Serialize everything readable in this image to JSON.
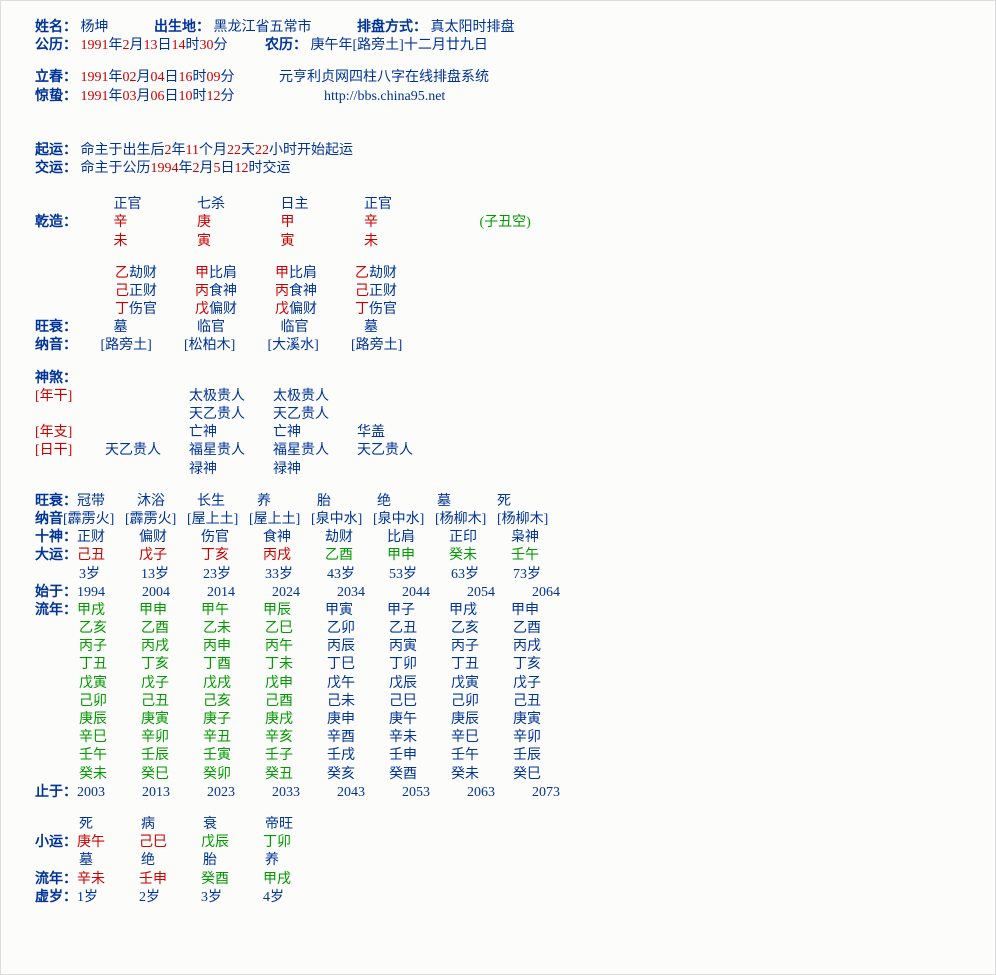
{
  "header": {
    "name_lbl": "姓名：",
    "name": "杨坤",
    "birthplace_lbl": "出生地：",
    "birthplace": "黑龙江省五常市",
    "mode_lbl": "排盘方式：",
    "mode": "真太阳时排盘",
    "solar_lbl": "公历：",
    "solar": {
      "y": "1991",
      "m": "2",
      "d": "13",
      "hh": "14",
      "mm": "30"
    },
    "lunar_lbl": "农历：",
    "lunar": "庚午年[路旁土]十二月廿九日",
    "lichun_lbl": "立春：",
    "lichun": {
      "y": "1991",
      "m": "02",
      "d": "04",
      "hh": "16",
      "mm": "09"
    },
    "jingzhe_lbl": "惊蛰：",
    "jingzhe": {
      "y": "1991",
      "m": "03",
      "d": "06",
      "hh": "10",
      "mm": "12"
    },
    "site1": "元亨利贞网四柱八字在线排盘系统",
    "site2": "http://bbs.china95.net"
  },
  "luck": {
    "qiyun_lbl": "起运：",
    "qiyun": {
      "p1": "命主于出生后",
      "y": "2",
      "t1": "年",
      "m": "11",
      "t2": "个月",
      "d": "22",
      "t3": "天",
      "h": "22",
      "t4": "小时开始起运"
    },
    "jiaoyun_lbl": "交运：",
    "jiaoyun": {
      "p1": "命主于公历",
      "y": "1994",
      "t1": "年",
      "m": "2",
      "t2": "月",
      "d": "5",
      "t3": "日",
      "h": "12",
      "t4": "时交运"
    }
  },
  "pillars": {
    "ten_god_top": [
      "正官",
      "七杀",
      "日主",
      "正官"
    ],
    "qz_lbl": "乾造：",
    "stems": [
      "辛",
      "庚",
      "甲",
      "辛"
    ],
    "void": "(子丑空)",
    "branches": [
      "未",
      "寅",
      "寅",
      "未"
    ],
    "hidden": [
      [
        {
          "g": "乙",
          "t": "劫财"
        },
        {
          "g": "甲",
          "t": "比肩"
        },
        {
          "g": "甲",
          "t": "比肩"
        },
        {
          "g": "乙",
          "t": "劫财"
        }
      ],
      [
        {
          "g": "己",
          "t": "正财"
        },
        {
          "g": "丙",
          "t": "食神"
        },
        {
          "g": "丙",
          "t": "食神"
        },
        {
          "g": "己",
          "t": "正财"
        }
      ],
      [
        {
          "g": "丁",
          "t": "伤官"
        },
        {
          "g": "戊",
          "t": "偏财"
        },
        {
          "g": "戊",
          "t": "偏财"
        },
        {
          "g": "丁",
          "t": "伤官"
        }
      ]
    ],
    "ws_lbl": "旺衰：",
    "wangshuai": [
      "墓",
      "临官",
      "临官",
      "墓"
    ],
    "ny_lbl": "纳音：",
    "nayin": [
      "[路旁土]",
      "[松柏木]",
      "[大溪水]",
      "[路旁土]"
    ]
  },
  "shensha": {
    "title": "神煞：",
    "rows": [
      {
        "lbl": "[年干]",
        "c": [
          "",
          "太极贵人",
          "太极贵人",
          ""
        ]
      },
      {
        "lbl": "",
        "c": [
          "",
          "天乙贵人",
          "天乙贵人",
          ""
        ]
      },
      {
        "lbl": "[年支]",
        "c": [
          "",
          "亡神",
          "亡神",
          "华盖"
        ]
      },
      {
        "lbl": "[日干]",
        "c": [
          "天乙贵人",
          "福星贵人",
          "福星贵人",
          "天乙贵人"
        ]
      },
      {
        "lbl": "",
        "c": [
          "",
          "禄神",
          "禄神",
          ""
        ]
      }
    ]
  },
  "dayun": {
    "ws_lbl": "旺衰：",
    "ws": [
      "冠带",
      "沐浴",
      "长生",
      "养",
      "胎",
      "绝",
      "墓",
      "死"
    ],
    "ny_lbl": "纳音",
    "ny": [
      "[霹雳火]",
      "[霹雳火]",
      "[屋上土]",
      "[屋上土]",
      "[泉中水]",
      "[泉中水]",
      "[杨柳木]",
      "[杨柳木]"
    ],
    "sg_lbl": "十神：",
    "sg": [
      "正财",
      "偏财",
      "伤官",
      "食神",
      "劫财",
      "比肩",
      "正印",
      "枭神"
    ],
    "dy_lbl": "大运：",
    "dy": [
      "己丑",
      "戊子",
      "丁亥",
      "丙戌",
      "乙酉",
      "甲申",
      "癸未",
      "壬午"
    ],
    "age": [
      "3岁",
      "13岁",
      "23岁",
      "33岁",
      "43岁",
      "53岁",
      "63岁",
      "73岁"
    ],
    "start_lbl": "始于：",
    "start": [
      "1994",
      "2004",
      "2014",
      "2024",
      "2034",
      "2044",
      "2054",
      "2064"
    ],
    "ln_lbl": "流年：",
    "ln": [
      [
        "甲戌",
        "甲申",
        "甲午",
        "甲辰",
        "甲寅",
        "甲子",
        "甲戌",
        "甲申"
      ],
      [
        "乙亥",
        "乙酉",
        "乙未",
        "乙巳",
        "乙卯",
        "乙丑",
        "乙亥",
        "乙酉"
      ],
      [
        "丙子",
        "丙戌",
        "丙申",
        "丙午",
        "丙辰",
        "丙寅",
        "丙子",
        "丙戌"
      ],
      [
        "丁丑",
        "丁亥",
        "丁酉",
        "丁未",
        "丁巳",
        "丁卯",
        "丁丑",
        "丁亥"
      ],
      [
        "戊寅",
        "戊子",
        "戊戌",
        "戊申",
        "戊午",
        "戊辰",
        "戊寅",
        "戊子"
      ],
      [
        "己卯",
        "己丑",
        "己亥",
        "己酉",
        "己未",
        "己巳",
        "己卯",
        "己丑"
      ],
      [
        "庚辰",
        "庚寅",
        "庚子",
        "庚戌",
        "庚申",
        "庚午",
        "庚辰",
        "庚寅"
      ],
      [
        "辛巳",
        "辛卯",
        "辛丑",
        "辛亥",
        "辛酉",
        "辛未",
        "辛巳",
        "辛卯"
      ],
      [
        "壬午",
        "壬辰",
        "壬寅",
        "壬子",
        "壬戌",
        "壬申",
        "壬午",
        "壬辰"
      ],
      [
        "癸未",
        "癸巳",
        "癸卯",
        "癸丑",
        "癸亥",
        "癸酉",
        "癸未",
        "癸巳"
      ]
    ],
    "end_lbl": "止于：",
    "end": [
      "2003",
      "2013",
      "2023",
      "2033",
      "2043",
      "2053",
      "2063",
      "2073"
    ]
  },
  "xiaoyun": {
    "ws": [
      "死",
      "病",
      "衰",
      "帝旺"
    ],
    "xy_lbl": "小运：",
    "xy": [
      "庚午",
      "己巳",
      "戊辰",
      "丁卯"
    ],
    "st": [
      "墓",
      "绝",
      "胎",
      "养"
    ],
    "ln_lbl": "流年：",
    "ln": [
      "辛未",
      "壬申",
      "癸酉",
      "甲戌"
    ],
    "xs_lbl": "虚岁：",
    "xs": [
      "1岁",
      "2岁",
      "3岁",
      "4岁"
    ]
  }
}
